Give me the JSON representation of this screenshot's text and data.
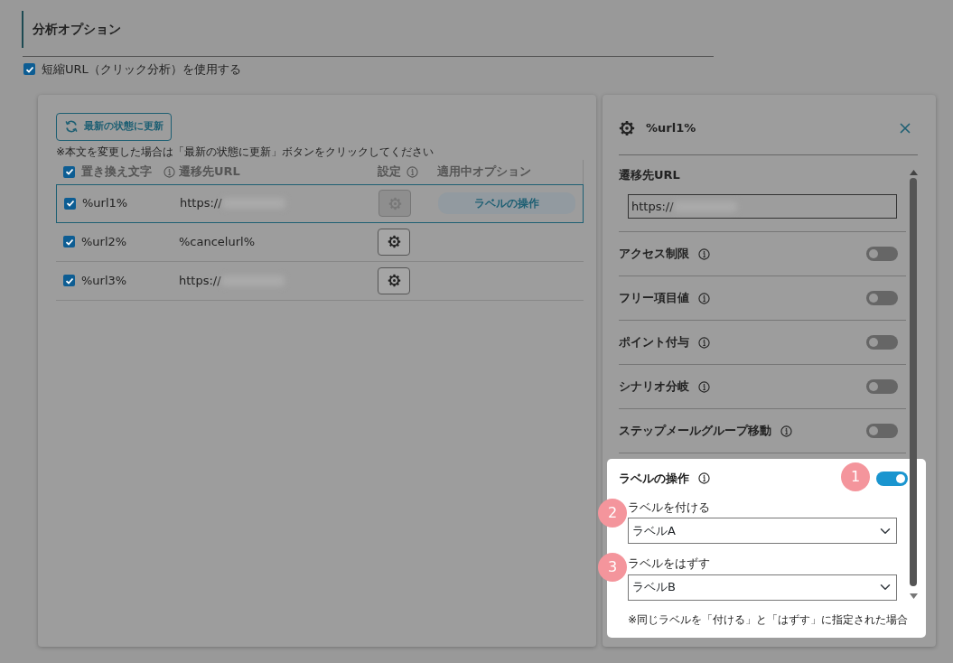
{
  "section_title": "分析オプション",
  "short_url": {
    "label": "短縮URL（クリック分析）を使用する",
    "checked": true
  },
  "refresh_button": "最新の状態に更新",
  "note": "※本文を変更した場合は「最新の状態に更新」ボタンをクリックしてください",
  "table": {
    "select_all_checked": true,
    "columns": [
      {
        "label": "置き換え文字",
        "info": true
      },
      {
        "label": "遷移先URL",
        "info": false
      },
      {
        "label": "設定",
        "info": true
      },
      {
        "label": "適用中オプション",
        "info": false
      }
    ],
    "rows": [
      {
        "tag": "%url1%",
        "checked": true,
        "url": "https://",
        "redacted": true,
        "selected": true,
        "options": [
          "ラベルの操作"
        ]
      },
      {
        "tag": "%url2%",
        "checked": true,
        "url": "%cancelurl%",
        "redacted": false,
        "selected": false,
        "options": []
      },
      {
        "tag": "%url3%",
        "checked": true,
        "url": "https://",
        "redacted": true,
        "selected": false,
        "options": []
      }
    ]
  },
  "detail_panel": {
    "title": "%url1%",
    "url_label": "遷移先URL",
    "url_value": "https://",
    "url_redacted": true,
    "options": [
      {
        "label": "アクセス制限",
        "on": false
      },
      {
        "label": "フリー項目値",
        "on": false
      },
      {
        "label": "ポイント付与",
        "on": false
      },
      {
        "label": "シナリオ分岐",
        "on": false
      },
      {
        "label": "ステップメールグループ移動",
        "on": false
      }
    ],
    "label_ops": {
      "label": "ラベルの操作",
      "on": true,
      "add_label": "ラベルを付ける",
      "add_value": "ラベルA",
      "remove_label": "ラベルをはずす",
      "remove_value": "ラベルB",
      "note": "※同じラベルを「付ける」と「はずす」に指定された場合"
    }
  },
  "callouts": [
    "1",
    "2",
    "3"
  ]
}
